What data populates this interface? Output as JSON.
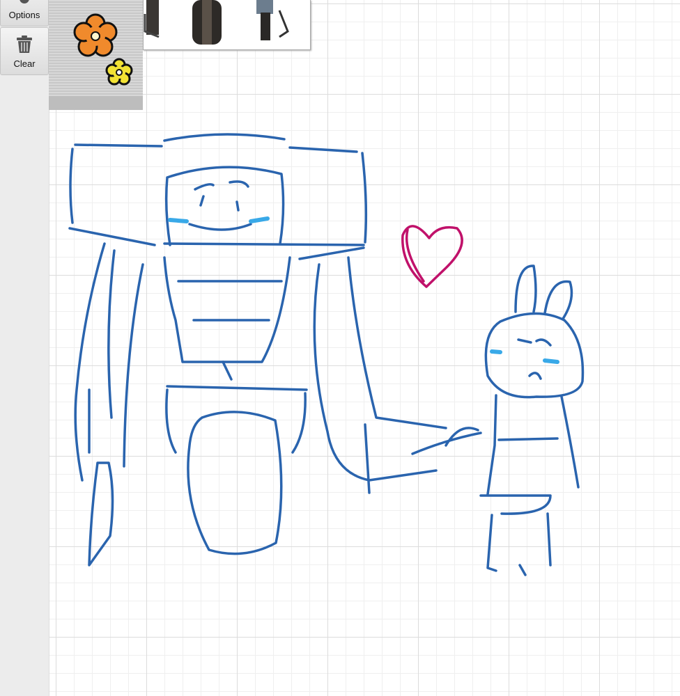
{
  "toolbar": {
    "options_label": "Options",
    "clear_label": "Clear"
  },
  "colors": {
    "ink_blue": "#2a64ae",
    "blush_blue": "#39a9e8",
    "heart_magenta": "#c0116a"
  }
}
